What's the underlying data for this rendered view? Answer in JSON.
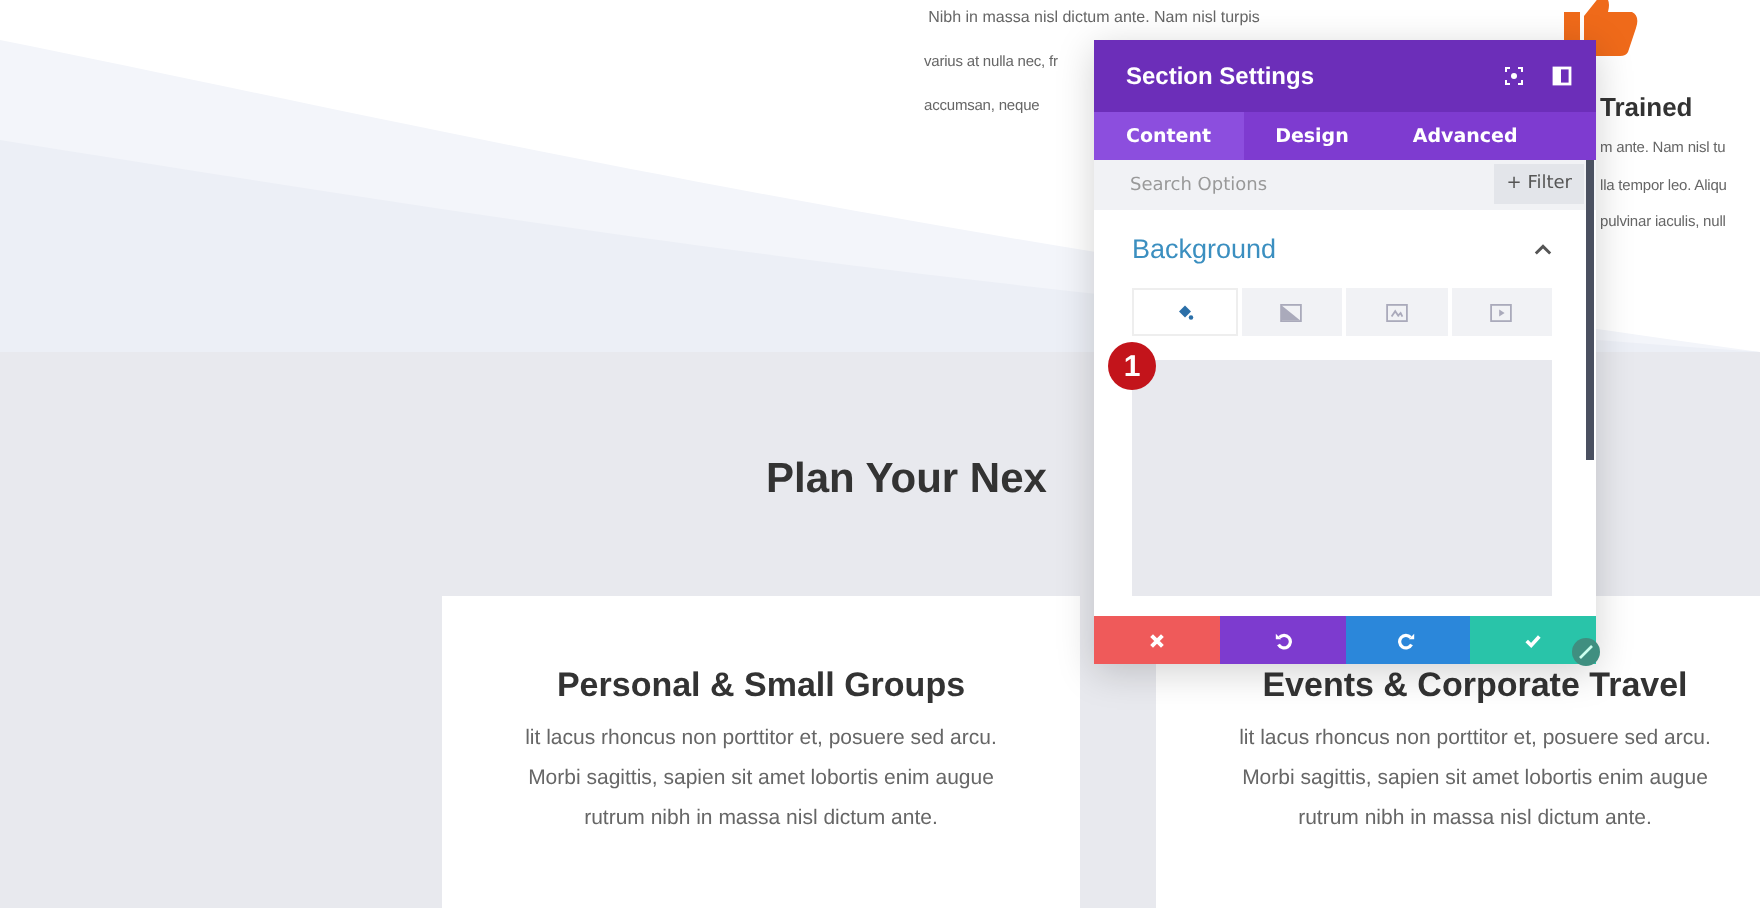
{
  "intro": {
    "lines": [
      "Nibh in massa nisl dictum ante. Nam nisl turpis",
      "varius at nulla nec, fr",
      "accumsan, neque"
    ]
  },
  "feature": {
    "title": "Trained",
    "lines": [
      "m ante. Nam nisl tu",
      "lla tempor leo. Aliqu",
      "pulvinar iaculis, null"
    ]
  },
  "section": {
    "heading": "Plan Your Nex"
  },
  "cards": [
    {
      "title": "Personal & Small Groups",
      "lines": [
        "lit lacus rhoncus non porttitor et, posuere sed arcu.",
        "Morbi sagittis, sapien sit amet lobortis enim augue",
        "rutrum nibh in massa nisl dictum ante."
      ]
    },
    {
      "title": "Events & Corporate Travel",
      "lines": [
        "lit lacus rhoncus non porttitor et, posuere sed arcu.",
        "Morbi sagittis, sapien sit amet lobortis enim augue",
        "rutrum nibh in massa nisl dictum ante."
      ]
    }
  ],
  "modal": {
    "title": "Section Settings",
    "tabs": [
      {
        "label": "Content",
        "selected": true
      },
      {
        "label": "Design",
        "selected": false
      },
      {
        "label": "Advanced",
        "selected": false
      }
    ],
    "search": {
      "placeholder": "Search Options"
    },
    "filter_button": "+ Filter",
    "group": {
      "title": "Background",
      "expanded": true
    },
    "bg_tabs": [
      {
        "kind": "color",
        "selected": true
      },
      {
        "kind": "gradient",
        "selected": false
      },
      {
        "kind": "image",
        "selected": false
      },
      {
        "kind": "video",
        "selected": false
      }
    ],
    "badge": "1",
    "actions": [
      {
        "kind": "cancel",
        "color": "#ef5a5a"
      },
      {
        "kind": "undo",
        "color": "#7d3bcf"
      },
      {
        "kind": "redo",
        "color": "#2b87da"
      },
      {
        "kind": "save",
        "color": "#29c4a9"
      }
    ]
  }
}
